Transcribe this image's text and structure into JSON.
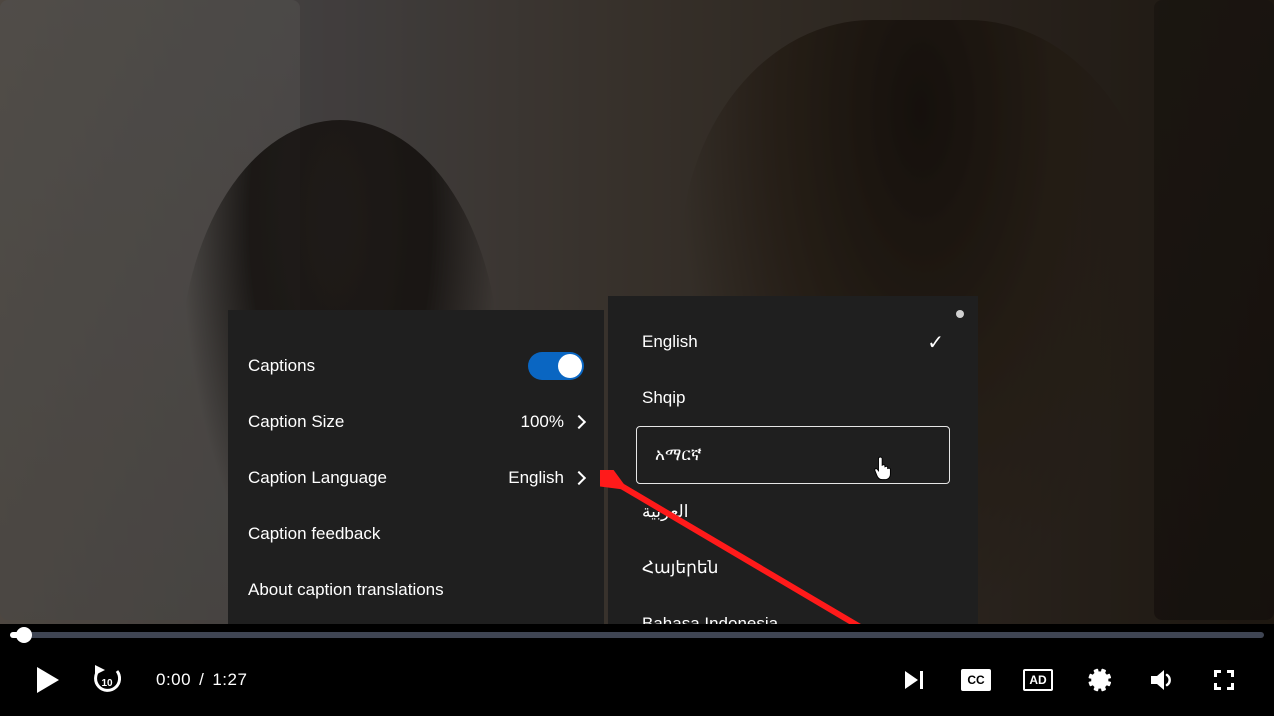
{
  "player": {
    "currentTime": "0:00",
    "duration": "1:27",
    "timeSeparator": "/",
    "ccBadge": "CC",
    "adBadge": "AD"
  },
  "captionsPanel": {
    "captionsLabel": "Captions",
    "captionsOn": true,
    "sizeLabel": "Caption Size",
    "sizeValue": "100%",
    "languageLabel": "Caption Language",
    "languageValue": "English",
    "feedbackLabel": "Caption feedback",
    "aboutLabel": "About caption translations"
  },
  "languagePanel": {
    "items": [
      {
        "label": "English",
        "selected": true
      },
      {
        "label": "Shqip",
        "selected": false
      },
      {
        "label": "አማርኛ",
        "selected": false,
        "outlined": true
      },
      {
        "label": "العربية",
        "selected": false
      },
      {
        "label": "Հայերեն",
        "selected": false
      },
      {
        "label": "Bahasa Indonesia",
        "selected": false
      }
    ]
  }
}
